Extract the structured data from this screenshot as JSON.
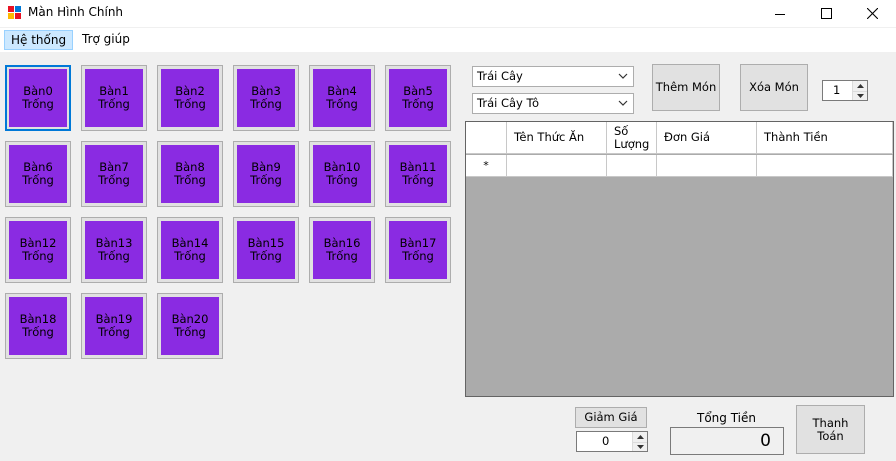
{
  "window": {
    "title": "Màn Hình Chính"
  },
  "menu": {
    "items": [
      {
        "label": "Hệ thống"
      },
      {
        "label": "Trợ giúp"
      }
    ]
  },
  "tables": [
    {
      "name": "Bàn0",
      "status": "Trống"
    },
    {
      "name": "Bàn1",
      "status": "Trống"
    },
    {
      "name": "Bàn2",
      "status": "Trống"
    },
    {
      "name": "Bàn3",
      "status": "Trống"
    },
    {
      "name": "Bàn4",
      "status": "Trống"
    },
    {
      "name": "Bàn5",
      "status": "Trống"
    },
    {
      "name": "Bàn6",
      "status": "Trống"
    },
    {
      "name": "Bàn7",
      "status": "Trống"
    },
    {
      "name": "Bàn8",
      "status": "Trống"
    },
    {
      "name": "Bàn9",
      "status": "Trống"
    },
    {
      "name": "Bàn10",
      "status": "Trống"
    },
    {
      "name": "Bàn11",
      "status": "Trống"
    },
    {
      "name": "Bàn12",
      "status": "Trống"
    },
    {
      "name": "Bàn13",
      "status": "Trống"
    },
    {
      "name": "Bàn14",
      "status": "Trống"
    },
    {
      "name": "Bàn15",
      "status": "Trống"
    },
    {
      "name": "Bàn16",
      "status": "Trống"
    },
    {
      "name": "Bàn17",
      "status": "Trống"
    },
    {
      "name": "Bàn18",
      "status": "Trống"
    },
    {
      "name": "Bàn19",
      "status": "Trống"
    },
    {
      "name": "Bàn20",
      "status": "Trống"
    }
  ],
  "order": {
    "category_select": "Trái Cây",
    "food_select": "Trái Cây Tô",
    "add_button": "Thêm Món",
    "remove_button": "Xóa Món",
    "quantity": "1"
  },
  "grid": {
    "columns": [
      "Tên Thức Ăn",
      "Số\nLượng",
      "Đơn Giá",
      "Thành Tiền"
    ],
    "new_row_marker": "*"
  },
  "footer": {
    "discount_button": "Giảm Giá",
    "discount_value": "0",
    "total_label": "Tổng Tiền",
    "total_value": "0",
    "checkout_button": "Thanh\nToán"
  },
  "colors": {
    "table_fill": "#8a2be2",
    "selection": "#0078d7"
  }
}
